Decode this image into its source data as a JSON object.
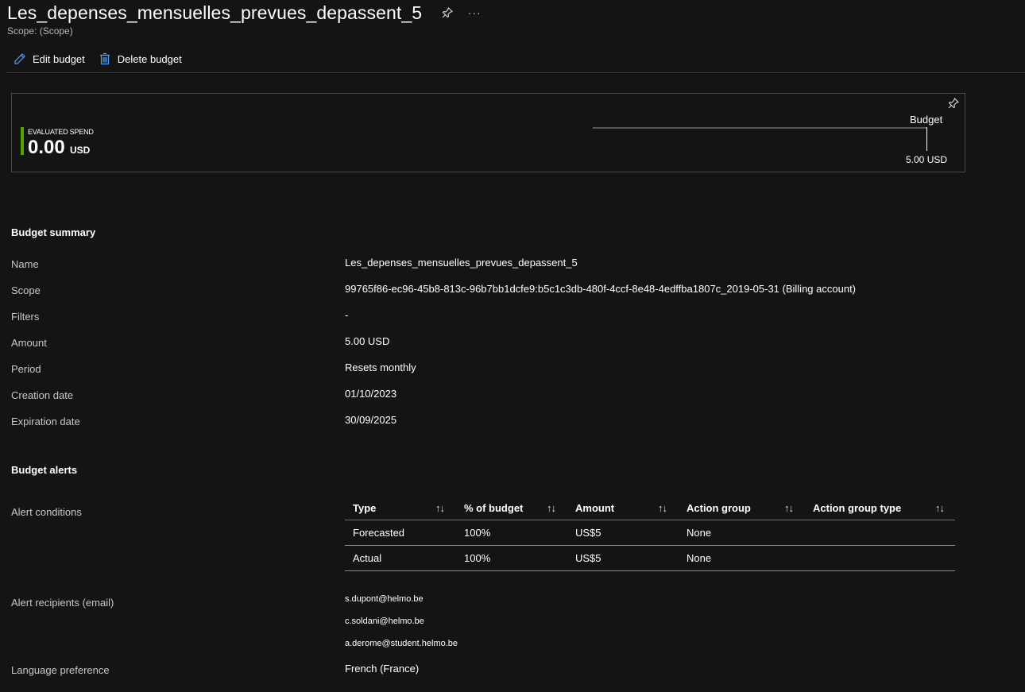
{
  "header": {
    "title": "Les_depenses_mensuelles_prevues_depassent_5",
    "scope": "Scope: (Scope)",
    "pin_icon": "pin-icon",
    "more_label": "···"
  },
  "toolbar": {
    "edit_label": "Edit budget",
    "edit_icon": "pencil-icon",
    "delete_label": "Delete budget",
    "delete_icon": "trash-icon"
  },
  "spend_card": {
    "label": "EVALUATED SPEND",
    "value": "0.00",
    "unit": "USD",
    "budget_label": "Budget",
    "budget_amount": "5.00 USD",
    "spend_fraction": 0.0,
    "accent_color": "#57a300"
  },
  "summary": {
    "title": "Budget summary",
    "rows": [
      {
        "label": "Name",
        "value": "Les_depenses_mensuelles_prevues_depassent_5"
      },
      {
        "label": "Scope",
        "value": "99765f86-ec96-45b8-813c-96b7bb1dcfe9:b5c1c3db-480f-4ccf-8e48-4edffba1807c_2019-05-31 (Billing account)"
      },
      {
        "label": "Filters",
        "value": "-"
      },
      {
        "label": "Amount",
        "value": "5.00 USD"
      },
      {
        "label": "Period",
        "value": "Resets monthly"
      },
      {
        "label": "Creation date",
        "value": "01/10/2023"
      },
      {
        "label": "Expiration date",
        "value": "30/09/2025"
      }
    ]
  },
  "alerts": {
    "title": "Budget alerts",
    "conditions_label": "Alert conditions",
    "columns": [
      "Type",
      "% of budget",
      "Amount",
      "Action group",
      "Action group type"
    ],
    "sort_glyph": "↑↓",
    "rows": [
      [
        "Forecasted",
        "100%",
        "US$5",
        "None",
        ""
      ],
      [
        "Actual",
        "100%",
        "US$5",
        "None",
        ""
      ]
    ],
    "recipients_label": "Alert recipients (email)",
    "recipients": [
      "s.dupont@helmo.be",
      "c.soldani@helmo.be",
      "a.derome@student.helmo.be"
    ],
    "language_label": "Language preference",
    "language_value": "French (France)"
  }
}
